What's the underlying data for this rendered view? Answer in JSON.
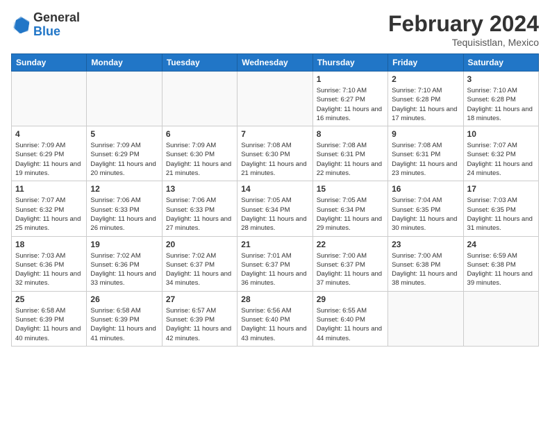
{
  "header": {
    "logo_general": "General",
    "logo_blue": "Blue",
    "month_title": "February 2024",
    "location": "Tequisistlan, Mexico"
  },
  "weekdays": [
    "Sunday",
    "Monday",
    "Tuesday",
    "Wednesday",
    "Thursday",
    "Friday",
    "Saturday"
  ],
  "weeks": [
    [
      {
        "day": "",
        "info": ""
      },
      {
        "day": "",
        "info": ""
      },
      {
        "day": "",
        "info": ""
      },
      {
        "day": "",
        "info": ""
      },
      {
        "day": "1",
        "info": "Sunrise: 7:10 AM\nSunset: 6:27 PM\nDaylight: 11 hours and 16 minutes."
      },
      {
        "day": "2",
        "info": "Sunrise: 7:10 AM\nSunset: 6:28 PM\nDaylight: 11 hours and 17 minutes."
      },
      {
        "day": "3",
        "info": "Sunrise: 7:10 AM\nSunset: 6:28 PM\nDaylight: 11 hours and 18 minutes."
      }
    ],
    [
      {
        "day": "4",
        "info": "Sunrise: 7:09 AM\nSunset: 6:29 PM\nDaylight: 11 hours and 19 minutes."
      },
      {
        "day": "5",
        "info": "Sunrise: 7:09 AM\nSunset: 6:29 PM\nDaylight: 11 hours and 20 minutes."
      },
      {
        "day": "6",
        "info": "Sunrise: 7:09 AM\nSunset: 6:30 PM\nDaylight: 11 hours and 21 minutes."
      },
      {
        "day": "7",
        "info": "Sunrise: 7:08 AM\nSunset: 6:30 PM\nDaylight: 11 hours and 21 minutes."
      },
      {
        "day": "8",
        "info": "Sunrise: 7:08 AM\nSunset: 6:31 PM\nDaylight: 11 hours and 22 minutes."
      },
      {
        "day": "9",
        "info": "Sunrise: 7:08 AM\nSunset: 6:31 PM\nDaylight: 11 hours and 23 minutes."
      },
      {
        "day": "10",
        "info": "Sunrise: 7:07 AM\nSunset: 6:32 PM\nDaylight: 11 hours and 24 minutes."
      }
    ],
    [
      {
        "day": "11",
        "info": "Sunrise: 7:07 AM\nSunset: 6:32 PM\nDaylight: 11 hours and 25 minutes."
      },
      {
        "day": "12",
        "info": "Sunrise: 7:06 AM\nSunset: 6:33 PM\nDaylight: 11 hours and 26 minutes."
      },
      {
        "day": "13",
        "info": "Sunrise: 7:06 AM\nSunset: 6:33 PM\nDaylight: 11 hours and 27 minutes."
      },
      {
        "day": "14",
        "info": "Sunrise: 7:05 AM\nSunset: 6:34 PM\nDaylight: 11 hours and 28 minutes."
      },
      {
        "day": "15",
        "info": "Sunrise: 7:05 AM\nSunset: 6:34 PM\nDaylight: 11 hours and 29 minutes."
      },
      {
        "day": "16",
        "info": "Sunrise: 7:04 AM\nSunset: 6:35 PM\nDaylight: 11 hours and 30 minutes."
      },
      {
        "day": "17",
        "info": "Sunrise: 7:03 AM\nSunset: 6:35 PM\nDaylight: 11 hours and 31 minutes."
      }
    ],
    [
      {
        "day": "18",
        "info": "Sunrise: 7:03 AM\nSunset: 6:36 PM\nDaylight: 11 hours and 32 minutes."
      },
      {
        "day": "19",
        "info": "Sunrise: 7:02 AM\nSunset: 6:36 PM\nDaylight: 11 hours and 33 minutes."
      },
      {
        "day": "20",
        "info": "Sunrise: 7:02 AM\nSunset: 6:37 PM\nDaylight: 11 hours and 34 minutes."
      },
      {
        "day": "21",
        "info": "Sunrise: 7:01 AM\nSunset: 6:37 PM\nDaylight: 11 hours and 36 minutes."
      },
      {
        "day": "22",
        "info": "Sunrise: 7:00 AM\nSunset: 6:37 PM\nDaylight: 11 hours and 37 minutes."
      },
      {
        "day": "23",
        "info": "Sunrise: 7:00 AM\nSunset: 6:38 PM\nDaylight: 11 hours and 38 minutes."
      },
      {
        "day": "24",
        "info": "Sunrise: 6:59 AM\nSunset: 6:38 PM\nDaylight: 11 hours and 39 minutes."
      }
    ],
    [
      {
        "day": "25",
        "info": "Sunrise: 6:58 AM\nSunset: 6:39 PM\nDaylight: 11 hours and 40 minutes."
      },
      {
        "day": "26",
        "info": "Sunrise: 6:58 AM\nSunset: 6:39 PM\nDaylight: 11 hours and 41 minutes."
      },
      {
        "day": "27",
        "info": "Sunrise: 6:57 AM\nSunset: 6:39 PM\nDaylight: 11 hours and 42 minutes."
      },
      {
        "day": "28",
        "info": "Sunrise: 6:56 AM\nSunset: 6:40 PM\nDaylight: 11 hours and 43 minutes."
      },
      {
        "day": "29",
        "info": "Sunrise: 6:55 AM\nSunset: 6:40 PM\nDaylight: 11 hours and 44 minutes."
      },
      {
        "day": "",
        "info": ""
      },
      {
        "day": "",
        "info": ""
      }
    ]
  ]
}
